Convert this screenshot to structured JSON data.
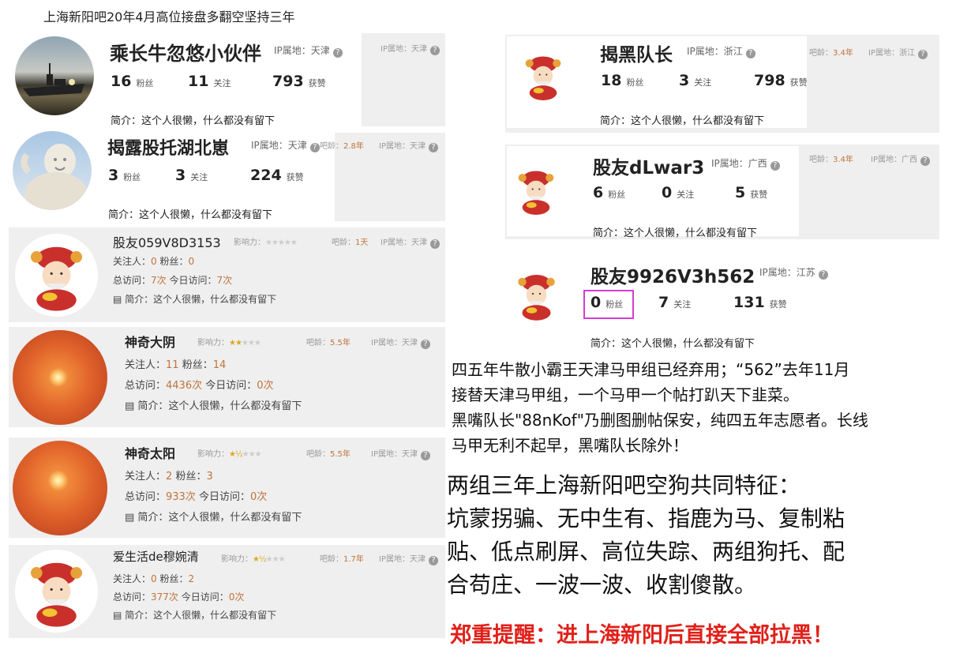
{
  "title": "上海新阳吧20年4月高位接盘多翻空坚持三年",
  "cards": [
    {
      "name": "乘长牛忽悠小伙伴",
      "ip": "IP属地：天津",
      "fans": "16",
      "follow": "11",
      "likes": "793",
      "intro": "简介：这个人很懒，什么都没有留下",
      "side_ip": "IP属地：天津"
    },
    {
      "name": "揭露股托湖北崽",
      "ip": "IP属地：天津",
      "age": "2.8年",
      "fans": "3",
      "follow": "3",
      "likes": "224",
      "intro": "简介：这个人很懒，什么都没有留下",
      "side_ip": "IP属地：天津"
    },
    {
      "name": "揭黑队长",
      "ip": "IP属地：浙江",
      "age": "3.4年",
      "fans": "18",
      "follow": "3",
      "likes": "798",
      "intro": "简介：这个人很懒，什么都没有留下",
      "side_ip": "IP属地：浙江"
    },
    {
      "name": "股友dLwar3",
      "ip": "IP属地：广西",
      "age": "3.4年",
      "fans": "6",
      "follow": "0",
      "likes": "5",
      "intro": "简介：这个人很懒，什么都没有留下",
      "side_ip": "IP属地：广西"
    },
    {
      "name": "股友9926V3h562",
      "ip": "IP属地：江苏",
      "fans": "0",
      "follow": "7",
      "likes": "131",
      "intro": "简介：这个人很懒，什么都没有留下"
    }
  ],
  "old_cards": [
    {
      "name": "股友059V8D3153",
      "influence": "影响力：",
      "age": "1天",
      "ip": "IP属地：天津",
      "followers": "0",
      "fans": "0",
      "visits": "7次",
      "today": "7次",
      "intro": "简介：这个人很懒，什么都没有留下"
    },
    {
      "name": "神奇大阴",
      "influence": "影响力：",
      "age": "5.5年",
      "ip": "IP属地：天津",
      "followers": "11",
      "fans": "14",
      "visits": "4436次",
      "today": "0次",
      "intro": "简介：这个人很懒，什么都没有留下"
    },
    {
      "name": "神奇太阳",
      "influence": "影响力：",
      "age": "5.5年",
      "ip": "IP属地：天津",
      "followers": "2",
      "fans": "3",
      "visits": "933次",
      "today": "0次",
      "intro": "简介：这个人很懒，什么都没有留下"
    },
    {
      "name": "爱生活de穆婉清",
      "influence": "影响力：",
      "age": "1.7年",
      "ip": "IP属地：天津",
      "followers": "0",
      "fans": "2",
      "visits": "377次",
      "today": "0次",
      "intro": "简介：这个人很懒，什么都没有留下"
    }
  ],
  "labels": {
    "fans": "粉丝",
    "follow": "关注",
    "likes": "获赞",
    "age_prefix": "吧龄：",
    "followers_prefix": "关注人：",
    "fans_prefix": "粉丝：",
    "visits_prefix": "总访问：",
    "today_prefix": "今日访问：",
    "q": "?"
  },
  "paragraph1": [
    "四五年牛散小霸王天津马甲组已经弃用；“562”去年11月",
    "接替天津马甲组，一个马甲一个帖打趴天下韭菜。",
    "黑嘴队长\"88nKof\"乃删图删帖保安，纯四五年志愿者。长线",
    "马甲无利不起早，黑嘴队长除外！"
  ],
  "paragraph2": [
    "两组三年上海新阳吧空狗共同特征：",
    "坑蒙拐骗、无中生有、指鹿为马、复制粘",
    "贴、低点刷屏、高位失踪、两组狗托、配",
    "合苟庄、一波一波、收割傻散。"
  ],
  "warning": "郑重提醒：进上海新阳后直接全部拉黑！",
  "colors": {
    "warning": "#e0211a",
    "highlight_box": "#d63ad6",
    "age": "#c0733c"
  }
}
